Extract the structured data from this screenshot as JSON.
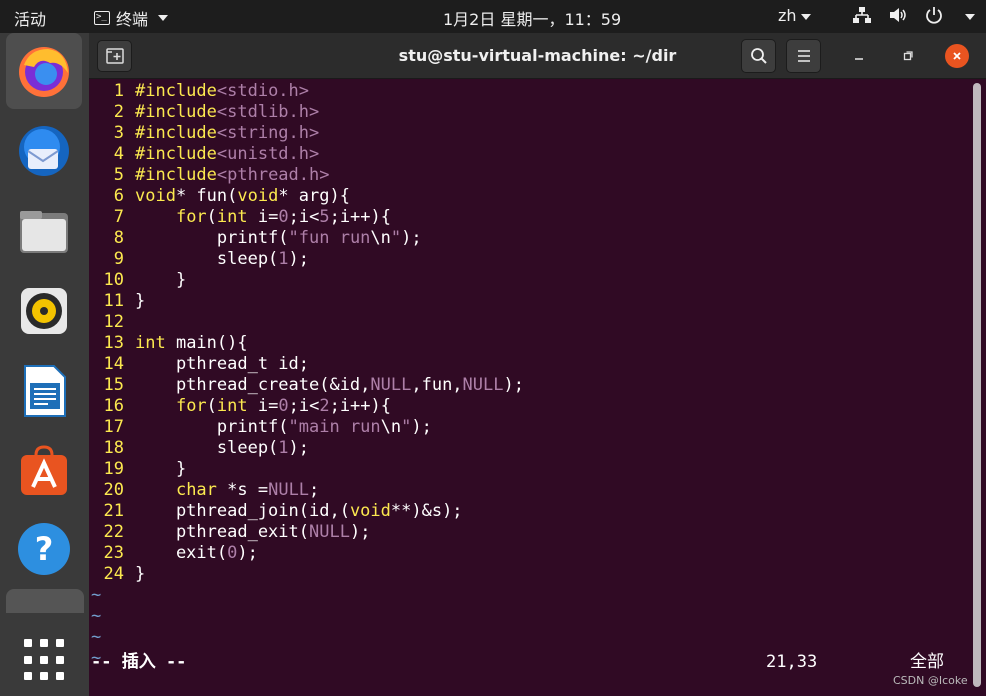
{
  "topbar": {
    "activities": "活动",
    "app_menu": "终端",
    "clock": "1月2日 星期一，11：59",
    "input_lang": "zh"
  },
  "window": {
    "title": "stu@stu-virtual-machine: ~/dir"
  },
  "editor": {
    "lines": [
      {
        "n": "1",
        "tokens": [
          [
            "kw",
            "#include"
          ],
          [
            "pre",
            "<stdio.h>"
          ]
        ]
      },
      {
        "n": "2",
        "tokens": [
          [
            "kw",
            "#include"
          ],
          [
            "pre",
            "<stdlib.h>"
          ]
        ]
      },
      {
        "n": "3",
        "tokens": [
          [
            "kw",
            "#include"
          ],
          [
            "pre",
            "<string.h>"
          ]
        ]
      },
      {
        "n": "4",
        "tokens": [
          [
            "kw",
            "#include"
          ],
          [
            "pre",
            "<unistd.h>"
          ]
        ]
      },
      {
        "n": "5",
        "tokens": [
          [
            "kw",
            "#include"
          ],
          [
            "pre",
            "<pthread.h>"
          ]
        ]
      },
      {
        "n": "6",
        "tokens": [
          [
            "kw",
            "void"
          ],
          [
            "n",
            "* fun("
          ],
          [
            "kw",
            "void"
          ],
          [
            "n",
            "* arg){"
          ]
        ]
      },
      {
        "n": "7",
        "tokens": [
          [
            "n",
            "    "
          ],
          [
            "kw",
            "for"
          ],
          [
            "n",
            "("
          ],
          [
            "kw",
            "int"
          ],
          [
            "n",
            " i="
          ],
          [
            "num",
            "0"
          ],
          [
            "n",
            ";i<"
          ],
          [
            "num",
            "5"
          ],
          [
            "n",
            ";i++){"
          ]
        ]
      },
      {
        "n": "8",
        "tokens": [
          [
            "n",
            "        printf("
          ],
          [
            "str",
            "\"fun run"
          ],
          [
            "n",
            "\\n"
          ],
          [
            "str",
            "\""
          ],
          [
            "n",
            ");"
          ]
        ]
      },
      {
        "n": "9",
        "tokens": [
          [
            "n",
            "        sleep("
          ],
          [
            "num",
            "1"
          ],
          [
            "n",
            ");"
          ]
        ]
      },
      {
        "n": "10",
        "tokens": [
          [
            "n",
            "    }"
          ]
        ]
      },
      {
        "n": "11",
        "tokens": [
          [
            "n",
            "}"
          ]
        ]
      },
      {
        "n": "12",
        "tokens": []
      },
      {
        "n": "13",
        "tokens": [
          [
            "kw",
            "int"
          ],
          [
            "n",
            " main(){"
          ]
        ]
      },
      {
        "n": "14",
        "tokens": [
          [
            "n",
            "    pthread_t id;"
          ]
        ]
      },
      {
        "n": "15",
        "tokens": [
          [
            "n",
            "    pthread_create(&id,"
          ],
          [
            "num",
            "NULL"
          ],
          [
            "n",
            ",fun,"
          ],
          [
            "num",
            "NULL"
          ],
          [
            "n",
            ");"
          ]
        ]
      },
      {
        "n": "16",
        "tokens": [
          [
            "n",
            "    "
          ],
          [
            "kw",
            "for"
          ],
          [
            "n",
            "("
          ],
          [
            "kw",
            "int"
          ],
          [
            "n",
            " i="
          ],
          [
            "num",
            "0"
          ],
          [
            "n",
            ";i<"
          ],
          [
            "num",
            "2"
          ],
          [
            "n",
            ";i++){"
          ]
        ]
      },
      {
        "n": "17",
        "tokens": [
          [
            "n",
            "        printf("
          ],
          [
            "str",
            "\"main run"
          ],
          [
            "n",
            "\\n"
          ],
          [
            "str",
            "\""
          ],
          [
            "n",
            ");"
          ]
        ]
      },
      {
        "n": "18",
        "tokens": [
          [
            "n",
            "        sleep("
          ],
          [
            "num",
            "1"
          ],
          [
            "n",
            ");"
          ]
        ]
      },
      {
        "n": "19",
        "tokens": [
          [
            "n",
            "    }"
          ]
        ]
      },
      {
        "n": "20",
        "tokens": [
          [
            "n",
            "    "
          ],
          [
            "kw",
            "char"
          ],
          [
            "n",
            " *s ="
          ],
          [
            "num",
            "NULL"
          ],
          [
            "n",
            ";"
          ]
        ]
      },
      {
        "n": "21",
        "tokens": [
          [
            "n",
            "    pthread_join(id,("
          ],
          [
            "kw",
            "void"
          ],
          [
            "n",
            "**)&s);"
          ]
        ]
      },
      {
        "n": "22",
        "tokens": [
          [
            "n",
            "    pthread_exit("
          ],
          [
            "num",
            "NULL"
          ],
          [
            "n",
            ");"
          ]
        ]
      },
      {
        "n": "23",
        "tokens": [
          [
            "n",
            "    exit("
          ],
          [
            "num",
            "0"
          ],
          [
            "n",
            ");"
          ]
        ]
      },
      {
        "n": "24",
        "tokens": [
          [
            "n",
            "}"
          ]
        ]
      }
    ],
    "tilde_lines": [
      "~",
      "~",
      "~",
      "~"
    ]
  },
  "status": {
    "mode": "-- 插入 --",
    "cursor": "21,33",
    "scroll": "全部"
  },
  "watermark": "CSDN @Icoke",
  "colors": {
    "terminal_bg": "#300a24",
    "line_number": "#fce94f",
    "keyword": "#fce94f",
    "constant": "#ad7fa8",
    "close_button": "#e95420"
  },
  "dock": {
    "items": [
      "firefox-icon",
      "thunderbird-icon",
      "files-icon",
      "rhythmbox-icon",
      "libreoffice-writer-icon",
      "software-center-icon",
      "help-icon",
      "terminal-icon",
      "show-apps-icon"
    ]
  }
}
